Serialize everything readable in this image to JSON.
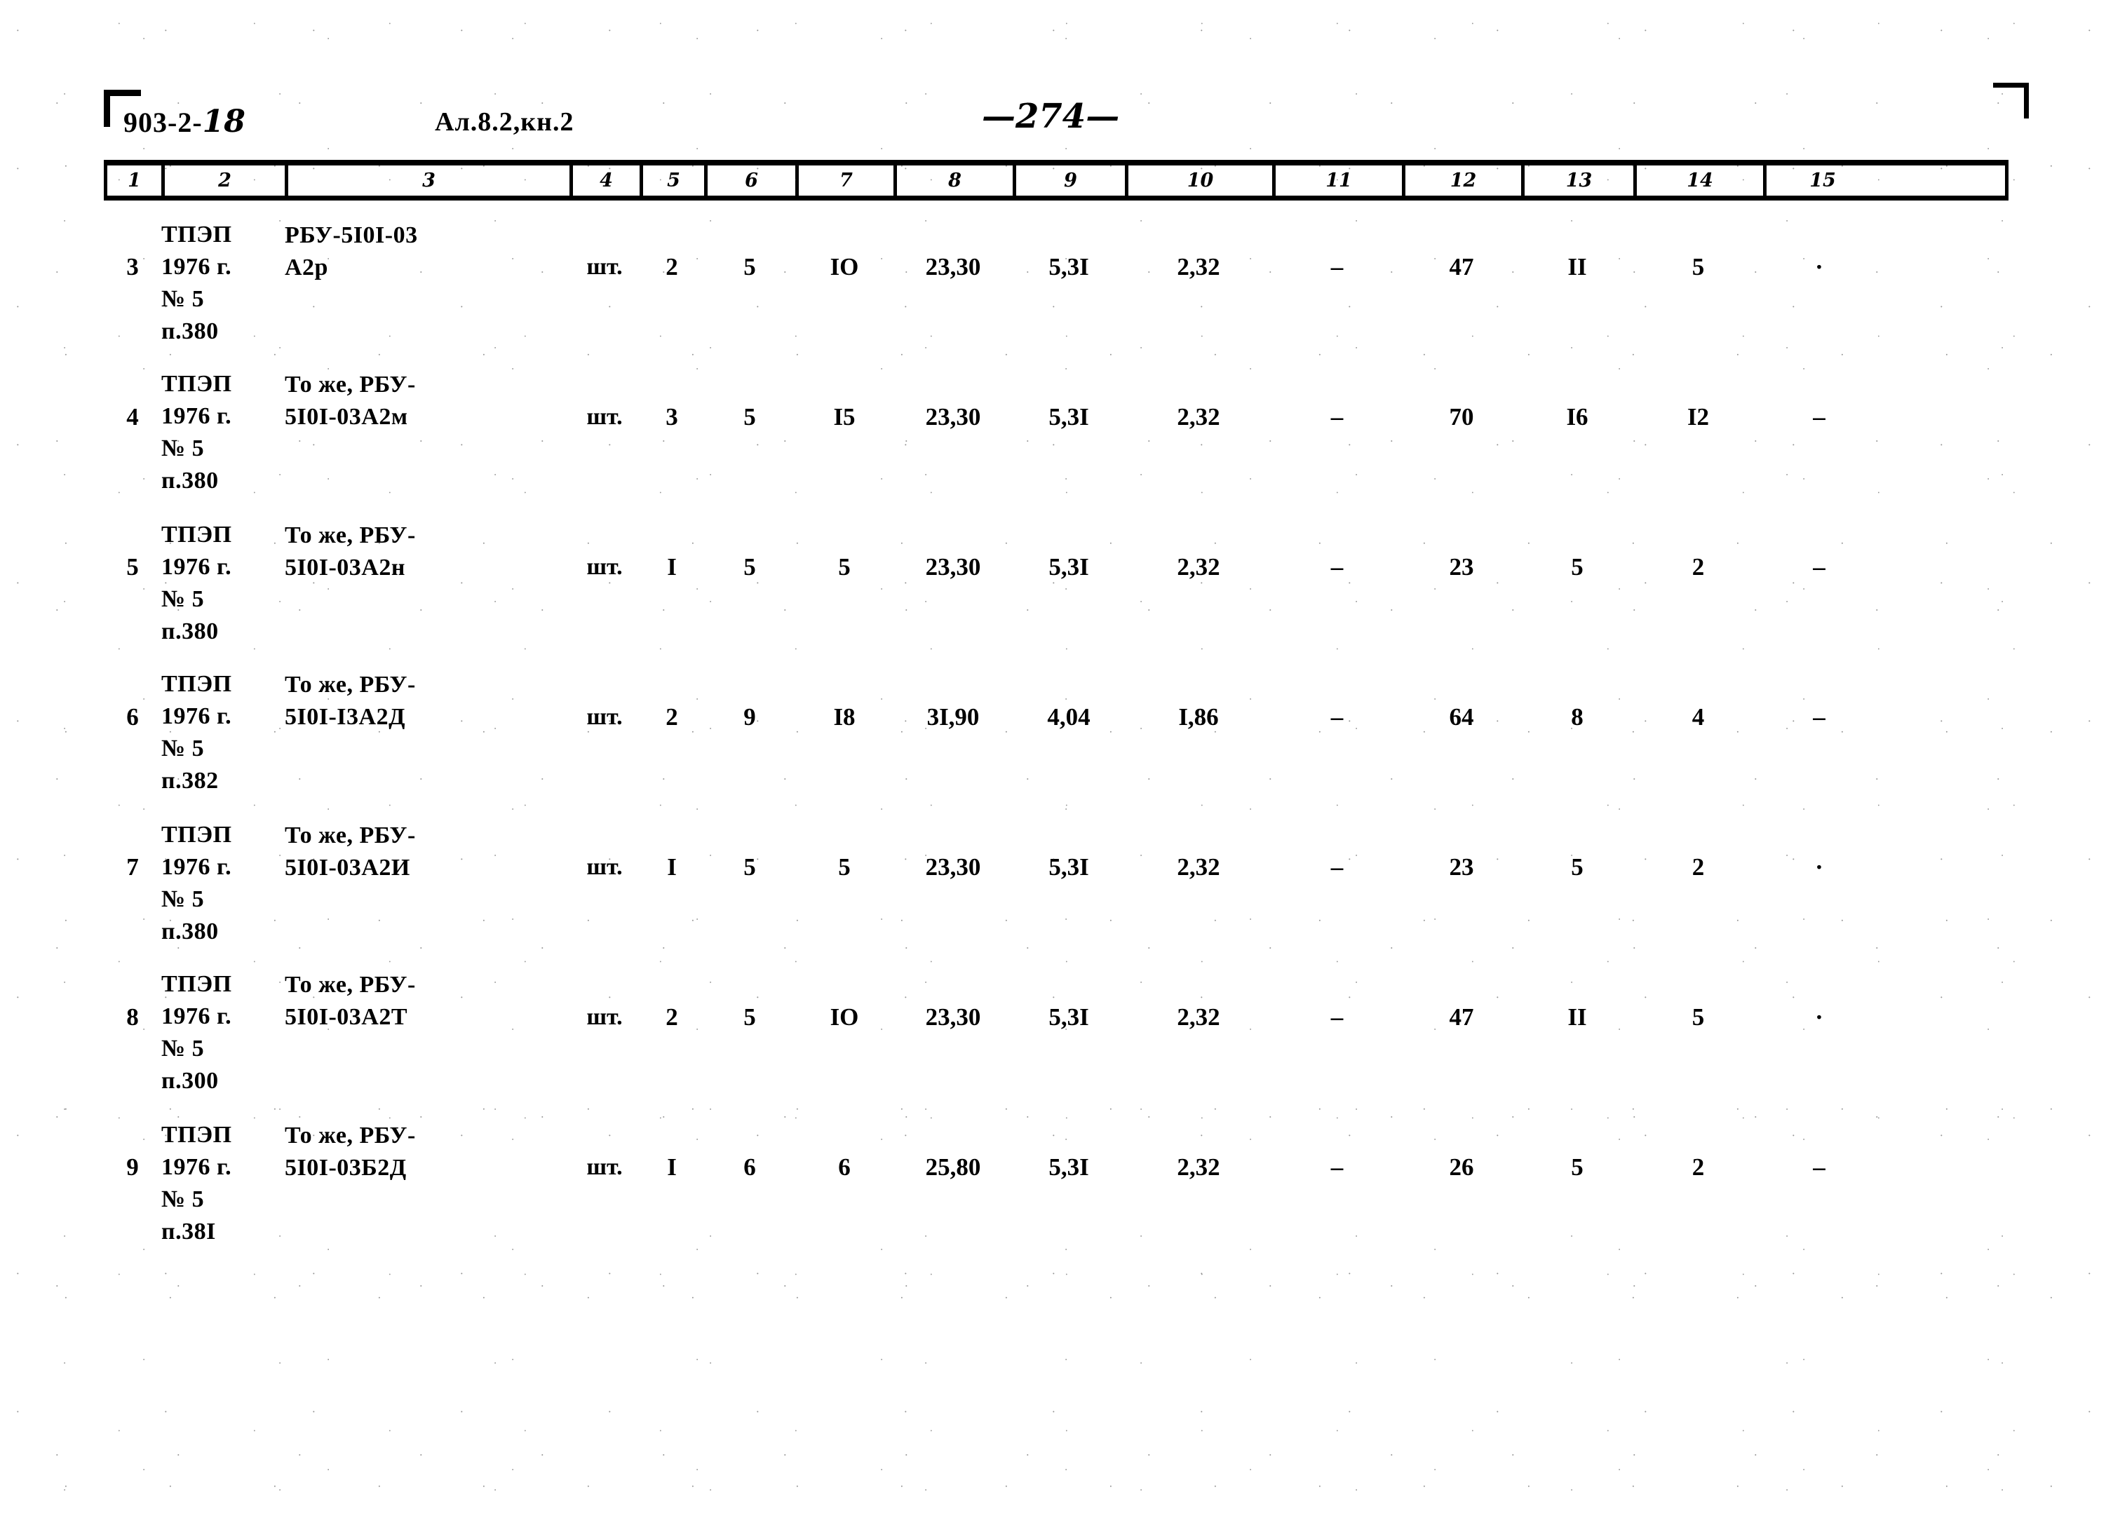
{
  "header": {
    "series_code": "903-2-",
    "series_code_hand": "18",
    "album": "Ал.8.2,кн.2",
    "page_number": "—274—"
  },
  "table": {
    "column_numbers": [
      "1",
      "2",
      "3",
      "4",
      "5",
      "6",
      "7",
      "8",
      "9",
      "10",
      "11",
      "12",
      "13",
      "14",
      "15"
    ],
    "rows": [
      {
        "num": "3",
        "source": "ТПЭП\n1976 г.\n№ 5\nп.380",
        "name": "РБУ-5I0I-03\nА2р",
        "unit": "шт.",
        "c5": "2",
        "c6": "5",
        "c7": "IO",
        "c8": "23,30",
        "c9": "5,3I",
        "c10": "2,32",
        "c11": "–",
        "c12": "47",
        "c13": "II",
        "c14": "5",
        "c15": "·"
      },
      {
        "num": "4",
        "source": "ТПЭП\n1976 г.\n№ 5\nп.380",
        "name": "То же, РБУ-\n5I0I-03А2м",
        "unit": "шт.",
        "c5": "3",
        "c6": "5",
        "c7": "I5",
        "c8": "23,30",
        "c9": "5,3I",
        "c10": "2,32",
        "c11": "–",
        "c12": "70",
        "c13": "I6",
        "c14": "I2",
        "c15": "–"
      },
      {
        "num": "5",
        "source": "ТПЭП\n1976 г.\n№ 5\nп.380",
        "name": "То же, РБУ-\n5I0I-03А2н",
        "unit": "шт.",
        "c5": "I",
        "c6": "5",
        "c7": "5",
        "c8": "23,30",
        "c9": "5,3I",
        "c10": "2,32",
        "c11": "–",
        "c12": "23",
        "c13": "5",
        "c14": "2",
        "c15": "–"
      },
      {
        "num": "6",
        "source": "ТПЭП\n1976 г.\n№ 5\nп.382",
        "name": "То же, РБУ-\n5I0I-I3А2Д",
        "unit": "шт.",
        "c5": "2",
        "c6": "9",
        "c7": "I8",
        "c8": "3I,90",
        "c9": "4,04",
        "c10": "I,86",
        "c11": "–",
        "c12": "64",
        "c13": "8",
        "c14": "4",
        "c15": "–"
      },
      {
        "num": "7",
        "source": "ТПЭП\n1976 г.\n№ 5\nп.380",
        "name": "То же, РБУ-\n5I0I-03А2И",
        "unit": "шт.",
        "c5": "I",
        "c6": "5",
        "c7": "5",
        "c8": "23,30",
        "c9": "5,3I",
        "c10": "2,32",
        "c11": "–",
        "c12": "23",
        "c13": "5",
        "c14": "2",
        "c15": "·"
      },
      {
        "num": "8",
        "source": "ТПЭП\n1976 г.\n№ 5\nп.300",
        "name": "То же, РБУ-\n5I0I-03А2Т",
        "unit": "шт.",
        "c5": "2",
        "c6": "5",
        "c7": "IO",
        "c8": "23,30",
        "c9": "5,3I",
        "c10": "2,32",
        "c11": "–",
        "c12": "47",
        "c13": "II",
        "c14": "5",
        "c15": "·"
      },
      {
        "num": "9",
        "source": "ТПЭП\n1976 г.\n№ 5\nп.38I",
        "name": "То же, РБУ-\n5I0I-03Б2Д",
        "unit": "шт.",
        "c5": "I",
        "c6": "6",
        "c7": "6",
        "c8": "25,80",
        "c9": "5,3I",
        "c10": "2,32",
        "c11": "–",
        "c12": "26",
        "c13": "5",
        "c14": "2",
        "c15": "–"
      }
    ]
  }
}
